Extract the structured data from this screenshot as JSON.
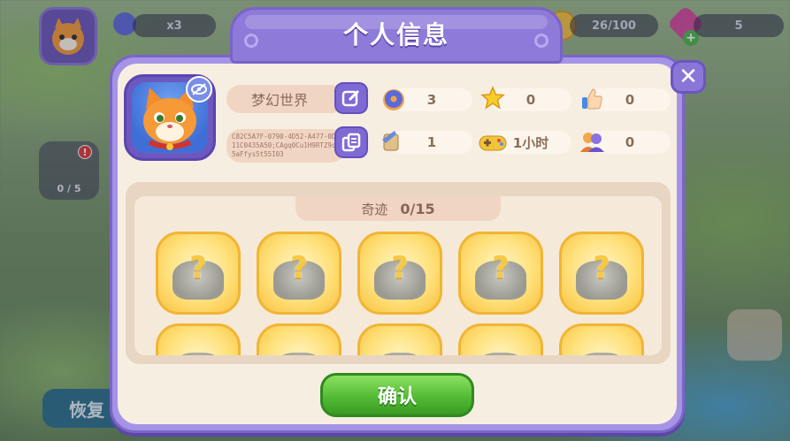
{
  "hud": {
    "boost_count": "x3",
    "coins": "26/100",
    "gems": "5"
  },
  "side": {
    "progress": "0 / 5",
    "badge": "!"
  },
  "restore_label": "恢复",
  "dialog": {
    "title": "个人信息",
    "close": "✕",
    "profile": {
      "name": "梦幻世界",
      "player_id": "C82C5A7F-0790-4D52-A477-0D11C0435A50;CAgq0Cu1H9RTZ9c5aFfys5t55I03"
    },
    "stats": [
      {
        "icon": "donut-icon",
        "value": "3"
      },
      {
        "icon": "star-icon",
        "value": "0"
      },
      {
        "icon": "thumbs-up-icon",
        "value": "0"
      },
      {
        "icon": "quest-scroll-icon",
        "value": "1"
      },
      {
        "icon": "gamepad-icon",
        "value": "1小时"
      },
      {
        "icon": "friends-icon",
        "value": "0"
      }
    ],
    "wonders": {
      "label": "奇迹",
      "count": "0/15"
    },
    "confirm": "确认"
  },
  "colors": {
    "panel_border": "#7c64c8",
    "panel_fill": "#f7eee2",
    "confirm_green": "#4fb832",
    "card_gold": "#ffe07a"
  }
}
